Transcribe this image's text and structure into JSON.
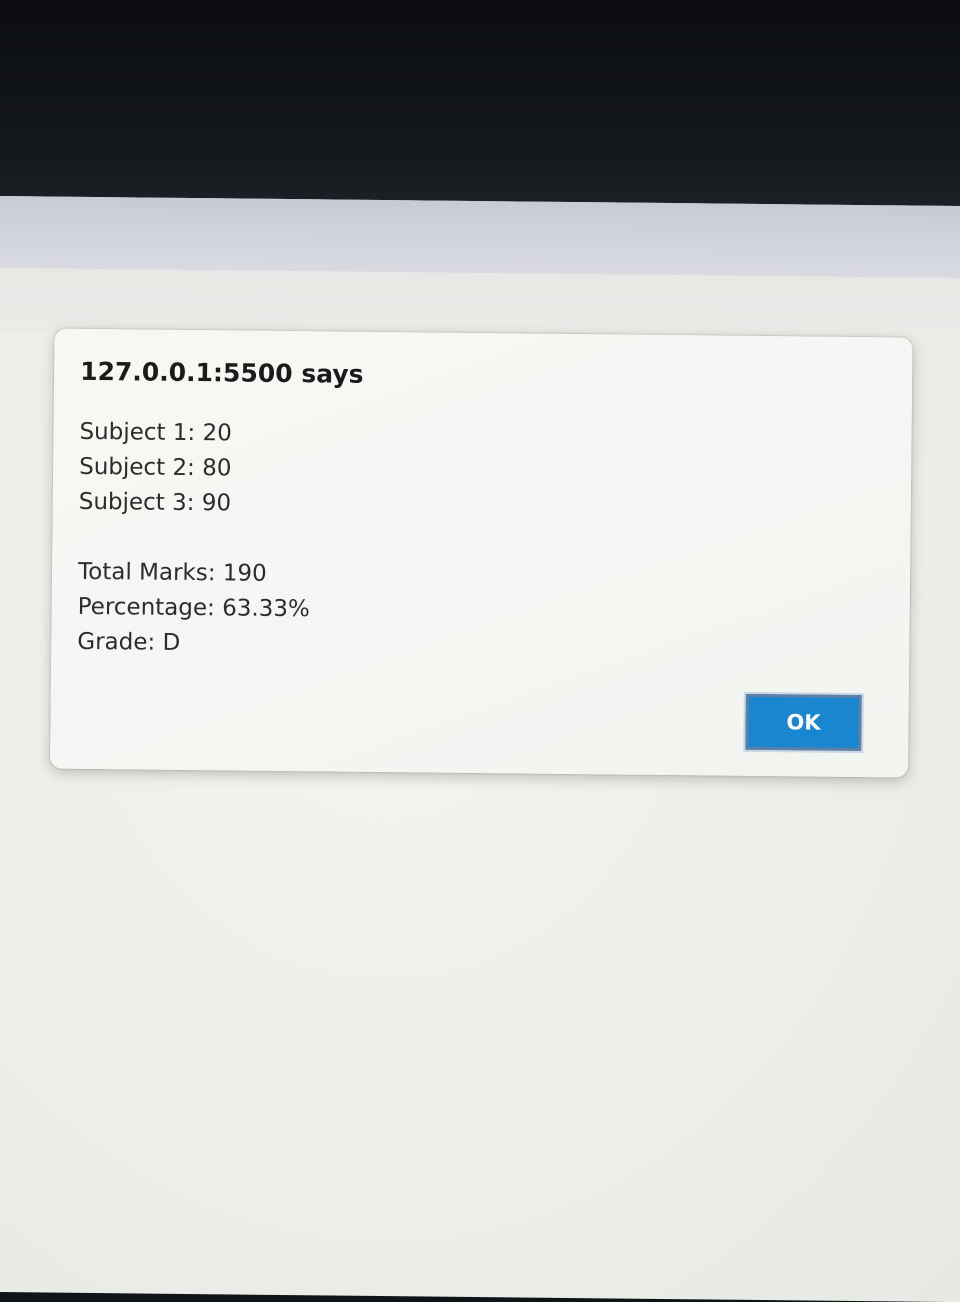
{
  "dialog": {
    "title": "127.0.0.1:5500 says",
    "lines": [
      "Subject 1: 20",
      "Subject 2: 80",
      "Subject 3: 90",
      "",
      "Total Marks: 190",
      "Percentage: 63.33%",
      "Grade: D"
    ],
    "ok_label": "OK"
  },
  "colors": {
    "ok_button": "#1a86cf",
    "dialog_background": "#f5f7f4",
    "bezel": "#111417"
  }
}
